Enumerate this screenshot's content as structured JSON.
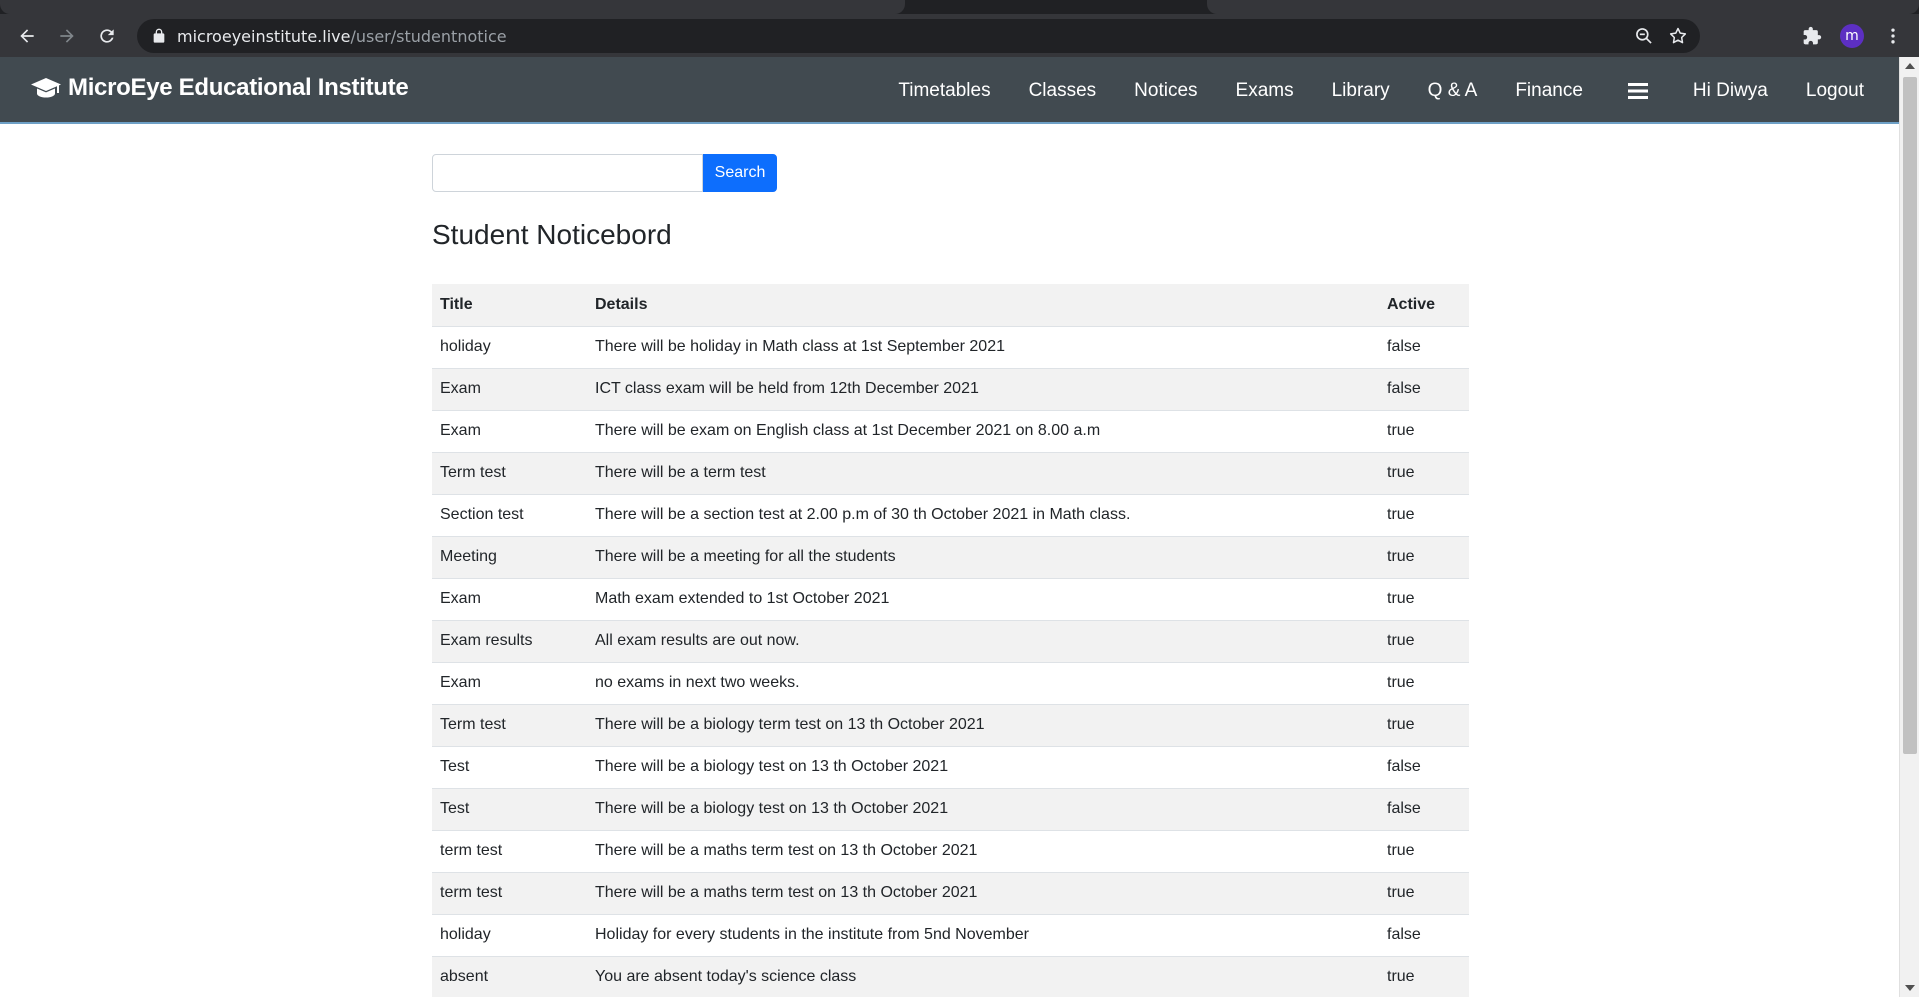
{
  "browser": {
    "url_host": "microeyeinstitute.live",
    "url_path": "/user/studentnotice",
    "profile_initial": "m"
  },
  "navbar": {
    "brand": "MicroEye Educational Institute",
    "links": [
      "Timetables",
      "Classes",
      "Notices",
      "Exams",
      "Library",
      "Q & A",
      "Finance"
    ],
    "greeting": "Hi Diwya",
    "logout": "Logout"
  },
  "search": {
    "value": "",
    "button_label": "Search"
  },
  "page_title": "Student Noticebord",
  "table": {
    "headers": [
      "Title",
      "Details",
      "Active"
    ],
    "rows": [
      [
        "holiday",
        "There will be holiday in Math class at 1st September 2021",
        "false"
      ],
      [
        "Exam",
        "ICT class exam will be held from 12th December 2021",
        "false"
      ],
      [
        "Exam",
        "There will be exam on English class at 1st December 2021 on 8.00 a.m",
        "true"
      ],
      [
        "Term test",
        "There will be a term test",
        "true"
      ],
      [
        "Section test",
        "There will be a section test at 2.00 p.m of 30 th October 2021 in Math class.",
        "true"
      ],
      [
        "Meeting",
        "There will be a meeting for all the students",
        "true"
      ],
      [
        "Exam",
        "Math exam extended to 1st October 2021",
        "true"
      ],
      [
        "Exam results",
        "All exam results are out now.",
        "true"
      ],
      [
        "Exam",
        "no exams in next two weeks.",
        "true"
      ],
      [
        "Term test",
        "There will be a biology term test on 13 th October 2021",
        "true"
      ],
      [
        "Test",
        "There will be a biology test on 13 th October 2021",
        "false"
      ],
      [
        "Test",
        "There will be a biology test on 13 th October 2021",
        "false"
      ],
      [
        "term test",
        "There will be a maths term test on 13 th October 2021",
        "true"
      ],
      [
        "term test",
        "There will be a maths term test on 13 th October 2021",
        "true"
      ],
      [
        "holiday",
        "Holiday for every students in the institute from 5nd November",
        "false"
      ],
      [
        "absent",
        "You are absent today's science class",
        "true"
      ]
    ]
  },
  "colors": {
    "navbar_bg": "#414a50",
    "primary_button": "#0d6efd",
    "row_stripe": "#f2f2f2"
  }
}
